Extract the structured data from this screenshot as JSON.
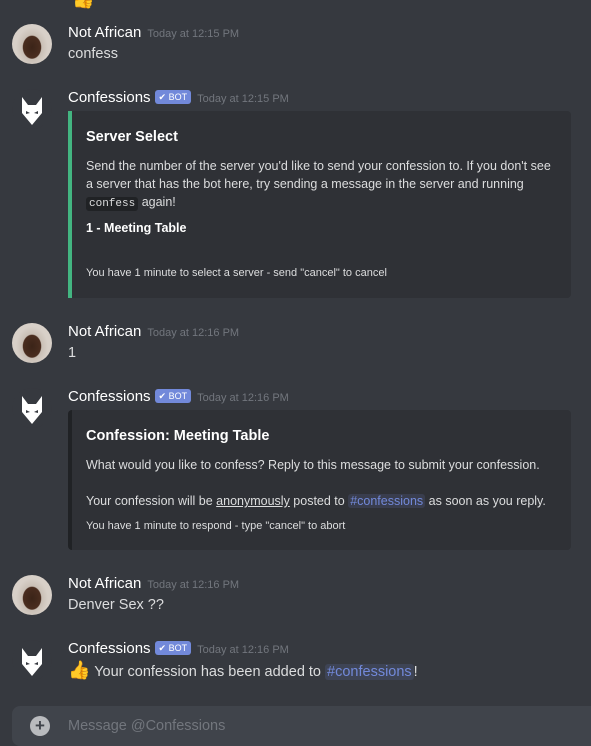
{
  "top_partial": {
    "emoji": "👍"
  },
  "messages": [
    {
      "author": "Not African",
      "timestamp": "Today at 12:15 PM",
      "text": "confess"
    },
    {
      "author": "Confessions",
      "badge": "BOT",
      "timestamp": "Today at 12:15 PM",
      "embed": {
        "title": "Server Select",
        "desc_before": "Send the number of the server you'd like to send your confession to. If you don't see a server that has the bot here, try sending a message in the server and running ",
        "desc_code": "confess",
        "desc_after": " again!",
        "option": "1 - Meeting Table",
        "footer": "You have 1 minute to select a server - send \"cancel\" to cancel",
        "accent": "#43b581"
      }
    },
    {
      "author": "Not African",
      "timestamp": "Today at 12:16 PM",
      "text": "1"
    },
    {
      "author": "Confessions",
      "badge": "BOT",
      "timestamp": "Today at 12:16 PM",
      "embed": {
        "title": "Confession: Meeting Table",
        "line1": "What would you like to confess? Reply to this message to submit your confession.",
        "line2_before": "Your confession will be ",
        "line2_underlined": "anonymously",
        "line2_middle": " posted to ",
        "line2_channel": "#confessions",
        "line2_after": " as soon as you reply.",
        "footer": "You have 1 minute to respond - type \"cancel\" to abort"
      }
    },
    {
      "author": "Not African",
      "timestamp": "Today at 12:16 PM",
      "text": "Denver Sex ??"
    },
    {
      "author": "Confessions",
      "badge": "BOT",
      "timestamp": "Today at 12:16 PM",
      "emoji": "👍",
      "text_before": " Your confession has been added to ",
      "channel": "#confessions",
      "text_after": "!"
    }
  ],
  "composer": {
    "placeholder": "Message @Confessions",
    "plus": "+"
  },
  "colors": {
    "background": "#36393f",
    "embed": "#2f3136",
    "mention": "#7289da",
    "badge": "#7289da"
  }
}
